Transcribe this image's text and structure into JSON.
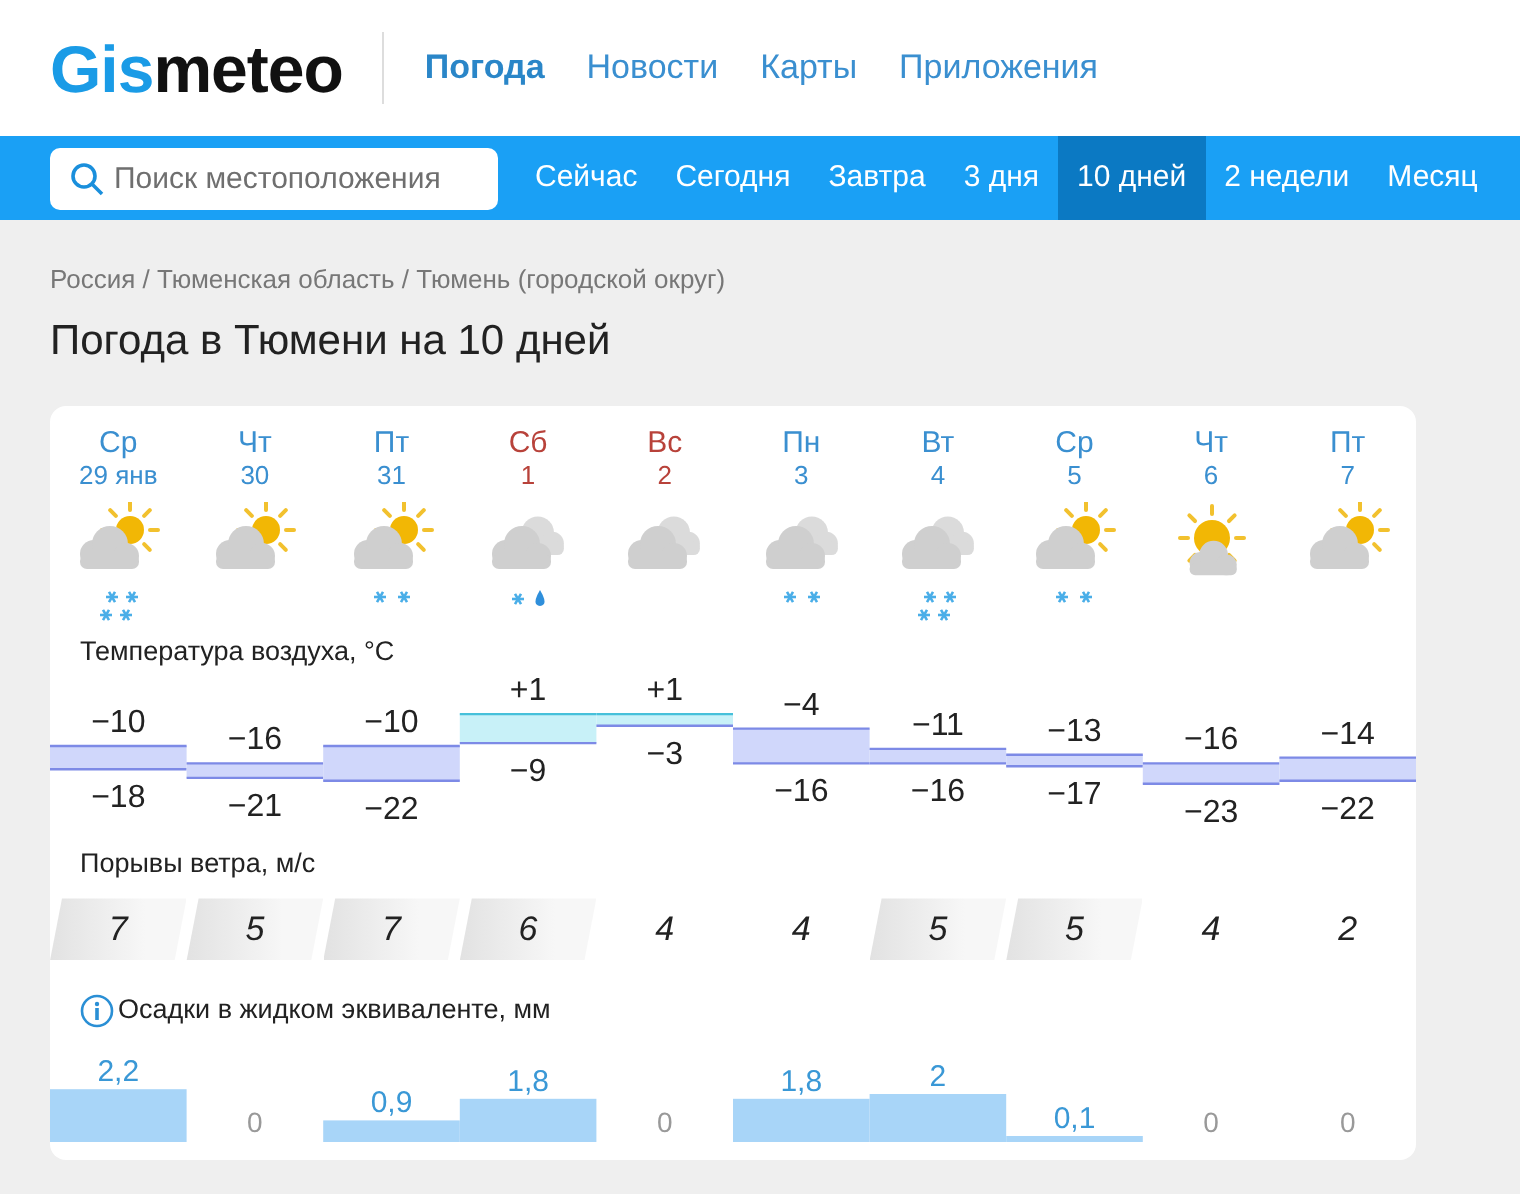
{
  "logo": {
    "parts": [
      "Gis",
      "meteo"
    ]
  },
  "main_nav": [
    {
      "label": "Погода",
      "selected": true
    },
    {
      "label": "Новости",
      "selected": false
    },
    {
      "label": "Карты",
      "selected": false
    },
    {
      "label": "Приложения",
      "selected": false
    }
  ],
  "search": {
    "placeholder": "Поиск местоположения"
  },
  "period_tabs": [
    {
      "label": "Сейчас",
      "selected": false
    },
    {
      "label": "Сегодня",
      "selected": false
    },
    {
      "label": "Завтра",
      "selected": false
    },
    {
      "label": "3 дня",
      "selected": false
    },
    {
      "label": "10 дней",
      "selected": true
    },
    {
      "label": "2 недели",
      "selected": false
    },
    {
      "label": "Месяц",
      "selected": false
    }
  ],
  "breadcrumb": "Россия / Тюменская область / Тюмень (городской округ)",
  "title": "Погода в Тюмени на 10 дней",
  "days": [
    {
      "dow": "Ср",
      "date": "29 янв",
      "weekend": false,
      "sky": {
        "kind": "partly-cloudy"
      },
      "precip": {
        "kind": "snow-heavy"
      },
      "tmax": "−10",
      "tmin": "−18",
      "gust": "7",
      "gust_shaded": true,
      "rain": "2,2"
    },
    {
      "dow": "Чт",
      "date": "30",
      "weekend": false,
      "sky": {
        "kind": "partly-cloudy"
      },
      "tmax": "−16",
      "tmin": "−21",
      "gust": "5",
      "gust_shaded": true,
      "rain": "0"
    },
    {
      "dow": "Пт",
      "date": "31",
      "weekend": false,
      "sky": {
        "kind": "partly-cloudy"
      },
      "precip": {
        "kind": "snow"
      },
      "tmax": "−10",
      "tmin": "−22",
      "gust": "7",
      "gust_shaded": true,
      "rain": "0,9"
    },
    {
      "dow": "Сб",
      "date": "1",
      "weekend": true,
      "sky": {
        "kind": "cloudy"
      },
      "precip": {
        "kind": "sleet"
      },
      "tmax": "+1",
      "tmin": "−9",
      "gust": "6",
      "gust_shaded": true,
      "rain": "1,8"
    },
    {
      "dow": "Вс",
      "date": "2",
      "weekend": true,
      "sky": {
        "kind": "cloudy"
      },
      "tmax": "+1",
      "tmin": "−3",
      "gust": "4",
      "gust_shaded": false,
      "rain": "0"
    },
    {
      "dow": "Пн",
      "date": "3",
      "weekend": false,
      "sky": {
        "kind": "cloudy"
      },
      "precip": {
        "kind": "snow"
      },
      "tmax": "−4",
      "tmin": "−16",
      "gust": "4",
      "gust_shaded": false,
      "rain": "1,8"
    },
    {
      "dow": "Вт",
      "date": "4",
      "weekend": false,
      "sky": {
        "kind": "cloudy"
      },
      "precip": {
        "kind": "snow-heavy"
      },
      "tmax": "−11",
      "tmin": "−16",
      "gust": "5",
      "gust_shaded": true,
      "rain": "2"
    },
    {
      "dow": "Ср",
      "date": "5",
      "weekend": false,
      "sky": {
        "kind": "partly-cloudy"
      },
      "precip": {
        "kind": "snow"
      },
      "tmax": "−13",
      "tmin": "−17",
      "gust": "5",
      "gust_shaded": true,
      "rain": "0,1"
    },
    {
      "dow": "Чт",
      "date": "6",
      "weekend": false,
      "sky": {
        "kind": "mostly-sunny"
      },
      "tmax": "−16",
      "tmin": "−23",
      "gust": "4",
      "gust_shaded": false,
      "rain": "0"
    },
    {
      "dow": "Пт",
      "date": "7",
      "weekend": false,
      "sky": {
        "kind": "partly-cloudy"
      },
      "tmax": "−14",
      "tmin": "−22",
      "gust": "2",
      "gust_shaded": false,
      "rain": "0"
    }
  ],
  "temperature": {
    "label": "Температура воздуха, °C"
  },
  "wind": {
    "label": "Порывы ветра, м/с"
  },
  "precipitation": {
    "label": "Осадки в жидком эквиваленте, мм"
  }
}
